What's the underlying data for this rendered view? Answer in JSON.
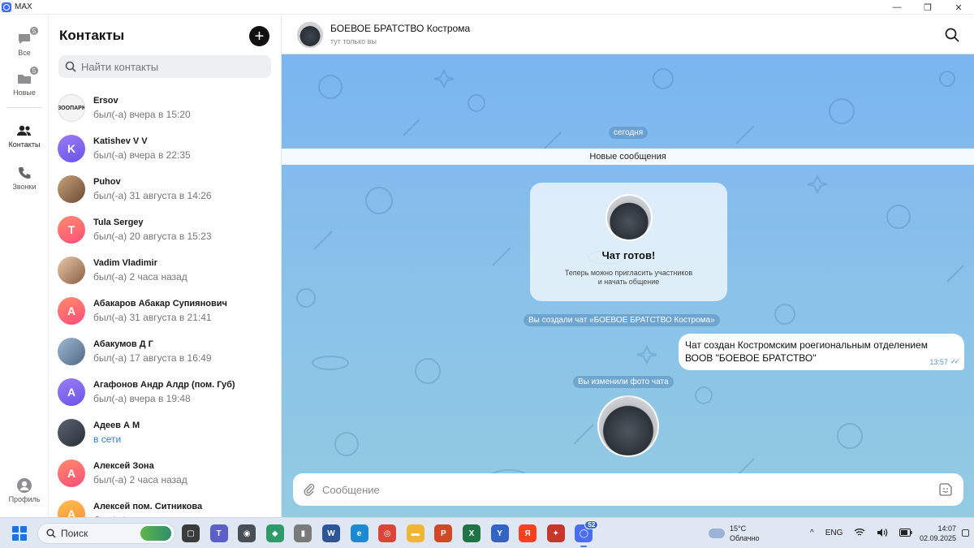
{
  "window": {
    "title": "MAX",
    "minimize": "—",
    "maximize": "❐",
    "close": "✕"
  },
  "rail": {
    "items": [
      {
        "label": "Все",
        "badge": "5"
      },
      {
        "label": "Новые",
        "badge": "5"
      },
      {
        "label": "Контакты",
        "badge": ""
      },
      {
        "label": "Звонки",
        "badge": ""
      }
    ],
    "profile_label": "Профиль"
  },
  "contacts": {
    "title": "Контакты",
    "add_icon": "+",
    "search_placeholder": "Найти контакты",
    "list": [
      {
        "name": "Ersov",
        "status": "был(-а) вчера в 15:20",
        "initial": "ЗООПАРК",
        "style": "logo",
        "online": false
      },
      {
        "name": "Katishev V V",
        "status": "был(-а) вчера в 22:35",
        "initial": "K",
        "style": "violet",
        "online": false
      },
      {
        "name": "Puhov",
        "status": "был(-а) 31 августа в 14:26",
        "initial": "",
        "style": "photo",
        "online": false
      },
      {
        "name": "Tula Sergey",
        "status": "был(-а) 20 августа в 15:23",
        "initial": "T",
        "style": "coral",
        "online": false
      },
      {
        "name": "Vadim Vladimir",
        "status": "был(-а) 2 часа назад",
        "initial": "",
        "style": "photo2",
        "online": false
      },
      {
        "name": "Абакаров Абакар Супиянович",
        "status": "был(-а) 31 августа в 21:41",
        "initial": "А",
        "style": "coral",
        "online": false
      },
      {
        "name": "Абакумов Д Г",
        "status": "был(-а) 17 августа в 16:49",
        "initial": "",
        "style": "photo3",
        "online": false
      },
      {
        "name": "Агафонов Андр Алдр (пом. Губ)",
        "status": "был(-а) вчера в 19:48",
        "initial": "А",
        "style": "violet",
        "online": false
      },
      {
        "name": "Адеев А М",
        "status": "в сети",
        "initial": "",
        "style": "photo4",
        "online": true
      },
      {
        "name": "Алексей Зона",
        "status": "был(-а) 2 часа назад",
        "initial": "А",
        "style": "coral",
        "online": false
      },
      {
        "name": "Алексей пом. Ситникова",
        "status": "был(-а) ...",
        "initial": "А",
        "style": "orange",
        "online": false
      }
    ]
  },
  "chat": {
    "title": "БОЕВОЕ БРАТСТВО Кострома",
    "subtitle": "тут только вы",
    "date_pill": "сегодня",
    "new_messages": "Новые сообщения",
    "ready_card": {
      "title": "Чат готов!",
      "text_line1": "Теперь можно пригласить участников",
      "text_line2": "и начать общение"
    },
    "created_pill": "Вы создали чат «БОЕВОЕ БРАТСТВО Кострома»",
    "outgoing": {
      "text_line1": "Чат создан Костромским роегиональным отделением",
      "text_line2": "ВООВ \"БОЕВОЕ БРАТСТВО\"",
      "time": "13:57"
    },
    "photo_pill": "Вы изменили фото чата",
    "composer_placeholder": "Сообщение"
  },
  "taskbar": {
    "search_label": "Поиск",
    "apps": [
      {
        "name": "task-view",
        "color": "#3b3b3b",
        "glyph": "▢",
        "badge": ""
      },
      {
        "name": "teams",
        "color": "#5b5fc7",
        "glyph": "T",
        "badge": ""
      },
      {
        "name": "camera",
        "color": "#4a4f57",
        "glyph": "◉",
        "badge": ""
      },
      {
        "name": "maps",
        "color": "#2f9b6b",
        "glyph": "◆",
        "badge": ""
      },
      {
        "name": "usb",
        "color": "#7a7a7a",
        "glyph": "▮",
        "badge": ""
      },
      {
        "name": "word",
        "color": "#2b579a",
        "glyph": "W",
        "badge": ""
      },
      {
        "name": "edge",
        "color": "#1b8ad3",
        "glyph": "e",
        "badge": ""
      },
      {
        "name": "chrome",
        "color": "#db4437",
        "glyph": "◎",
        "badge": ""
      },
      {
        "name": "explorer",
        "color": "#f2b632",
        "glyph": "▬",
        "badge": ""
      },
      {
        "name": "powerpoint",
        "color": "#d24726",
        "glyph": "P",
        "badge": ""
      },
      {
        "name": "excel",
        "color": "#217346",
        "glyph": "X",
        "badge": ""
      },
      {
        "name": "yandex-browser",
        "color": "#3264c8",
        "glyph": "Y",
        "badge": ""
      },
      {
        "name": "yandex",
        "color": "#fc3f1d",
        "glyph": "Я",
        "badge": ""
      },
      {
        "name": "game",
        "color": "#c8352a",
        "glyph": "✦",
        "badge": ""
      },
      {
        "name": "max",
        "color": "#4b6df5",
        "glyph": "◯",
        "badge": "52"
      }
    ],
    "weather_temp": "15°C",
    "weather_desc": "Облачно",
    "tray_up": "^",
    "lang": "ENG",
    "time": "14:07",
    "date": "02.09.2025"
  }
}
